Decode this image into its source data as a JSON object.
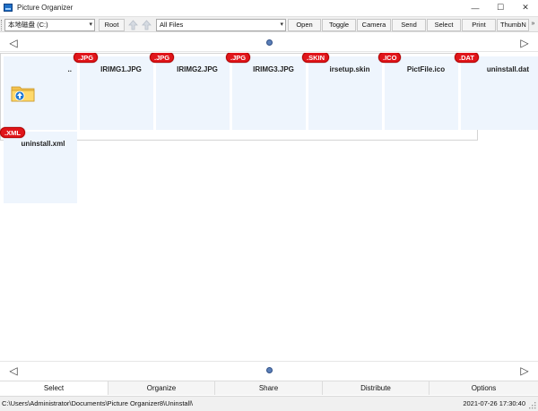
{
  "window": {
    "title": "Picture Organizer",
    "controls": {
      "minimize": "—",
      "maximize": "☐",
      "close": "✕"
    }
  },
  "toolbar": {
    "drive": "本地磁盘 (C:)",
    "root_label": "Root",
    "filter": "All Files",
    "buttons": [
      "Open",
      "Toggle",
      "Camera",
      "Send",
      "Select",
      "Print",
      "ThumbN"
    ],
    "overflow": "»"
  },
  "nav": {
    "prev": "◁",
    "next": "▷"
  },
  "tiles": [
    {
      "name": "..",
      "badge": ""
    },
    {
      "name": "IRIMG1.JPG",
      "badge": ".JPG"
    },
    {
      "name": "IRIMG2.JPG",
      "badge": ".JPG"
    },
    {
      "name": "IRIMG3.JPG",
      "badge": ".JPG"
    },
    {
      "name": "irsetup.skin",
      "badge": ".SKIN"
    },
    {
      "name": "PictFile.ico",
      "badge": ".ICO"
    },
    {
      "name": "uninstall.dat",
      "badge": ".DAT"
    },
    {
      "name": "uninstall.xml",
      "badge": ".XML"
    }
  ],
  "tabs": [
    "Select",
    "Organize",
    "Share",
    "Distribute",
    "Options"
  ],
  "status": {
    "path": "C:\\Users\\Administrator\\Documents\\Picture Organizer8\\Uninstall\\",
    "timestamp": "2021-07-26 17:30:40"
  }
}
